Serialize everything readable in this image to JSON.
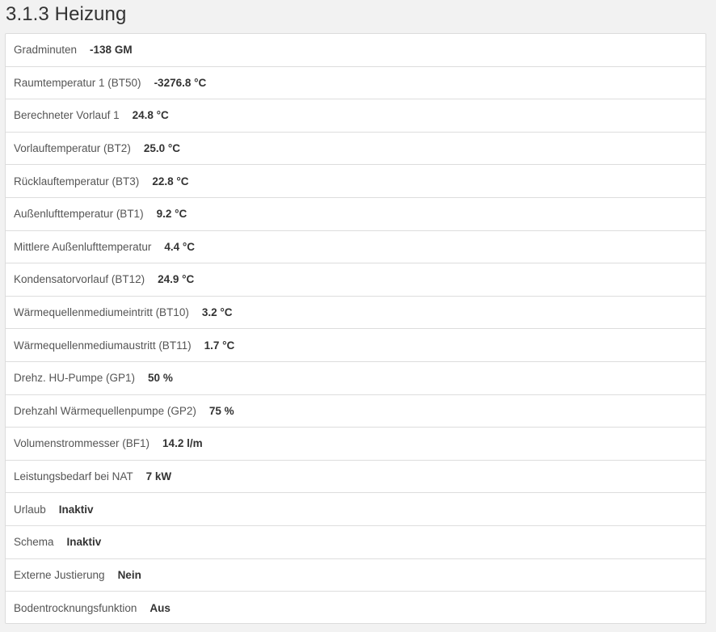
{
  "page": {
    "title": "3.1.3 Heizung"
  },
  "rows": [
    {
      "label": "Gradminuten",
      "value": "-138 GM"
    },
    {
      "label": "Raumtemperatur 1 (BT50)",
      "value": "-3276.8 °C"
    },
    {
      "label": "Berechneter Vorlauf 1",
      "value": "24.8 °C"
    },
    {
      "label": "Vorlauftemperatur (BT2)",
      "value": "25.0 °C"
    },
    {
      "label": "Rücklauftemperatur (BT3)",
      "value": "22.8 °C"
    },
    {
      "label": "Außenlufttemperatur (BT1)",
      "value": "9.2 °C"
    },
    {
      "label": "Mittlere Außenlufttemperatur",
      "value": "4.4 °C"
    },
    {
      "label": "Kondensatorvorlauf (BT12)",
      "value": "24.9 °C"
    },
    {
      "label": "Wärmequellenmediumeintritt (BT10)",
      "value": "3.2 °C"
    },
    {
      "label": "Wärmequellenmediumaustritt (BT11)",
      "value": "1.7 °C"
    },
    {
      "label": "Drehz. HU-Pumpe (GP1)",
      "value": "50 %"
    },
    {
      "label": "Drehzahl Wärmequellenpumpe (GP2)",
      "value": "75 %"
    },
    {
      "label": "Volumenstrommesser (BF1)",
      "value": "14.2 l/m"
    },
    {
      "label": "Leistungsbedarf bei NAT",
      "value": "7 kW"
    },
    {
      "label": "Urlaub",
      "value": "Inaktiv"
    },
    {
      "label": "Schema",
      "value": "Inaktiv"
    },
    {
      "label": "Externe Justierung",
      "value": "Nein"
    },
    {
      "label": "Bodentrocknungsfunktion",
      "value": "Aus"
    }
  ]
}
